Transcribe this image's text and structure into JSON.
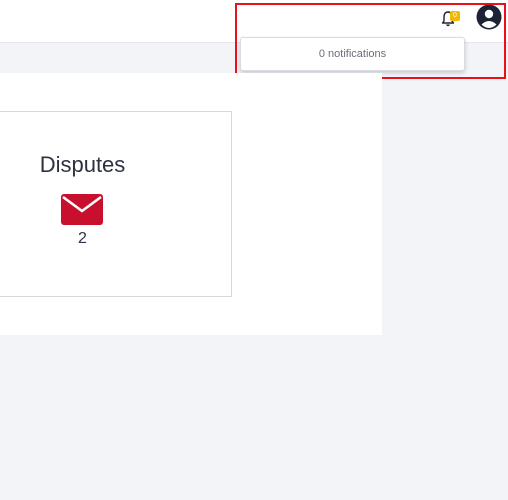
{
  "header": {
    "notification_count": "0",
    "notifications_dropdown_text": "0 notifications"
  },
  "card": {
    "title": "Disputes",
    "count": "2",
    "icon": "envelope-icon"
  },
  "colors": {
    "accent_red": "#c8102e",
    "badge_yellow": "#f5b800",
    "highlight_red": "#e8101a",
    "page_bg": "#f3f4f8"
  },
  "icons": {
    "bell": "bell-icon",
    "avatar": "user-avatar-icon"
  }
}
